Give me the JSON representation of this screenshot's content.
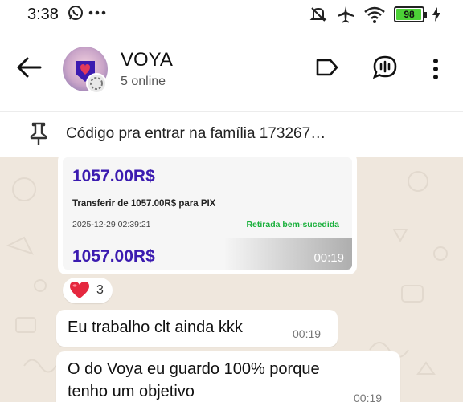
{
  "status_bar": {
    "time": "3:38",
    "battery": "98",
    "battery_level": 0.98
  },
  "header": {
    "name": "VOYA",
    "subtitle": "5 online"
  },
  "pinned": {
    "text": "Código pra entrar na família 173267…"
  },
  "messages": {
    "image": {
      "amount_top": "1057.00R$",
      "transfer_line": "Transferir de 1057.00R$ para PIX",
      "datetime": "2025-12-29 02:39:21",
      "status": "Retirada bem-sucedida",
      "amount_bottom": "1057.00R$",
      "time": "00:19"
    },
    "reaction": {
      "emoji": "❤️",
      "count": "3"
    },
    "msg1": {
      "text": "Eu trabalho clt ainda kkk",
      "time": "00:19"
    },
    "msg2": {
      "line1": "O do Voya eu guardo 100% porque",
      "line2": "tenho um objetivo",
      "time": "00:19"
    }
  },
  "colors": {
    "chat_background": "#efe7dd",
    "amount_purple": "#3b1bb0",
    "success_green": "#19b03b",
    "battery_green": "#4cd137"
  }
}
